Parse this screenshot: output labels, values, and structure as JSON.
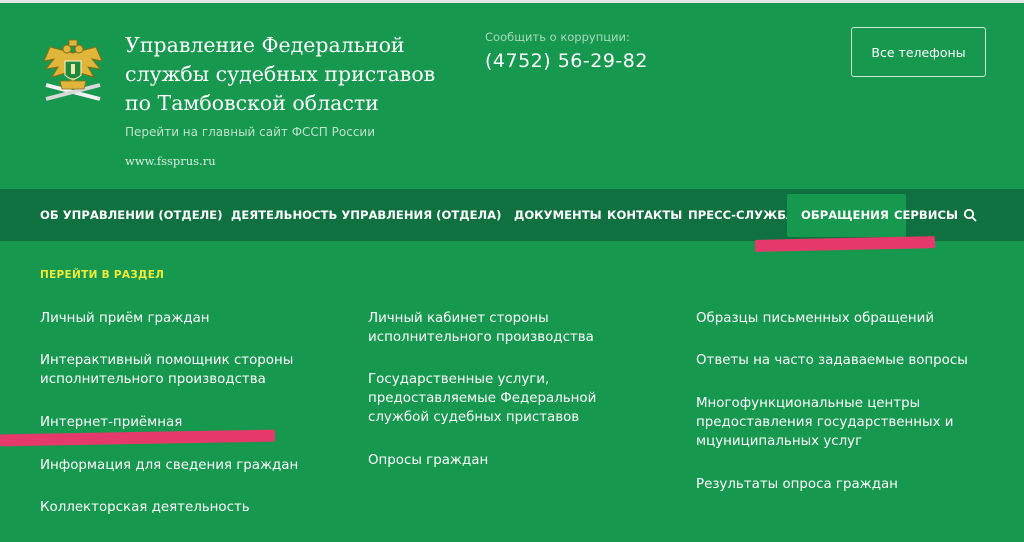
{
  "header": {
    "org_title": "Управление Федеральной службы судебных приставов по Тамбовской области",
    "main_site_link": "Перейти на главный сайт ФССП России",
    "site_url": "www.fssprus.ru",
    "corruption_label": "Сообщить о коррупции:",
    "corruption_phone": "(4752) 56-29-82",
    "all_phones_label": "Все телефоны"
  },
  "nav": {
    "items": [
      "ОБ УПРАВЛЕНИИ (ОТДЕЛЕ)",
      "ДЕЯТЕЛЬНОСТЬ УПРАВЛЕНИЯ (ОТДЕЛА)",
      "ДОКУМЕНТЫ",
      "КОНТАКТЫ",
      "ПРЕСС-СЛУЖБА",
      "ОБРАЩЕНИЯ",
      "СЕРВИСЫ"
    ],
    "active": "ОБРАЩЕНИЯ",
    "search_icon": "search-icon"
  },
  "dropdown": {
    "section_label": "ПЕРЕЙТИ В РАЗДЕЛ",
    "columns": [
      [
        "Личный приём граждан",
        "Интерактивный помощник стороны исполнительного производства",
        "Интернет-приёмная",
        "Информация для сведения граждан",
        "Коллекторская деятельность"
      ],
      [
        "Личный кабинет стороны исполнительного производства",
        "Государственные услуги, предоставляемые Федеральной службой судебных приставов",
        "Опросы граждан"
      ],
      [
        "Образцы письменных обращений",
        "Ответы на часто задаваемые вопросы",
        "Многофункциональные центры предоставления государственных и мцуниципальных услуг",
        "Результаты опроса граждан"
      ]
    ]
  },
  "colors": {
    "background": "#16984f",
    "navbar": "#0f7140",
    "section_label": "#f1ee39",
    "highlight": "#e5396b"
  }
}
